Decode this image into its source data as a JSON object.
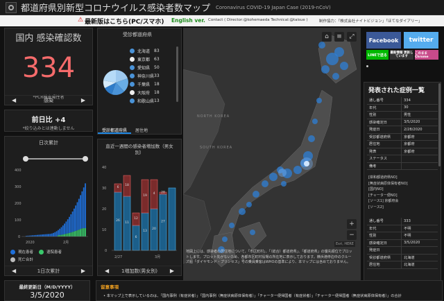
{
  "header": {
    "title": "都道府県別新型コロナウイルス感染者数マップ",
    "subtitle": "Coronavirus COVID-19 Japan Case (2019-nCoV)"
  },
  "banner": {
    "warn_icon": "⚠",
    "latest": "最新版はこちら(PC/スマホ)",
    "english": "English ver.",
    "contact": "Contact ( Director:@kohemaeda Technical:@taisue )",
    "producer": "制作協力：「株式会社ナイトビジョン」「ほてなダイアリー」"
  },
  "confirmed": {
    "title": "国内 感染確認数",
    "value": "334",
    "note": "*PCR検査陽性者",
    "nav_label": "感染"
  },
  "daily": {
    "title": "前日比 +4",
    "note": "*絞り込みとは連動しません"
  },
  "cumulative": {
    "title": "日次累計",
    "yticks": [
      "400",
      "300",
      "200",
      "100",
      "0"
    ],
    "xticks": [
      "2020",
      "2月"
    ],
    "legend": [
      "現在患者",
      "退院患者",
      "死亡合計"
    ],
    "nav_label": "1日次累計"
  },
  "prefectures": {
    "title": "受診都道府県",
    "items": [
      {
        "name": "北海道",
        "count": "83"
      },
      {
        "name": "東京都",
        "count": "63"
      },
      {
        "name": "愛知県",
        "count": "50"
      },
      {
        "name": "神奈川県",
        "count": "33"
      },
      {
        "name": "千葉県",
        "count": "18"
      },
      {
        "name": "大阪府",
        "count": "18"
      },
      {
        "name": "和歌山県",
        "count": "13"
      }
    ],
    "tab1": "受診都道府県",
    "tab2": "居住地"
  },
  "weekly": {
    "title": "直近一週間の感染者増加数（男女別）",
    "yticks": [
      "40",
      "30",
      "20",
      "10",
      "0"
    ],
    "xticks": [
      "2/27",
      "3月"
    ],
    "nav_label": "1増加数(男女別)",
    "bar_labels": [
      "26",
      "6",
      "11",
      "18",
      "6",
      "12",
      "13",
      "19",
      "20",
      "4",
      "27",
      "28"
    ]
  },
  "map": {
    "labels": [
      "NORTH KOREA",
      "SOUTH KOREA"
    ],
    "zoom_in": "+",
    "zoom_out": "−",
    "esri": "Esri, HERE",
    "caption": "地図上には、感染者の居住地について、「市区町村」、「（総合）都道府県」、「都道府県」の優先順位でプロットします。プロット先がないため、各都市区町村役場の所在地に表示しております。横浜港停泊中のクルーズ船「ダイヤモンド・プリンセス」号の乗員乗客はWHOの基準により、本マップには含めておりません。"
  },
  "social": {
    "facebook": "Facebook",
    "twitter": "twitter",
    "line": "LINEで送る",
    "latest": "最新情報 更新しています",
    "other": "このまま Chrome"
  },
  "case_panel": {
    "title": "発表された症例一覧",
    "case1": [
      {
        "k": "通し番号",
        "v": "334"
      },
      {
        "k": "年代",
        "v": "30"
      },
      {
        "k": "性別",
        "v": "男性"
      },
      {
        "k": "感染確定日",
        "v": "3/5/2020"
      },
      {
        "k": "発症日",
        "v": "2/28/2020"
      },
      {
        "k": "受診都道府県",
        "v": "京都府"
      },
      {
        "k": "居住地",
        "v": "京都府"
      },
      {
        "k": "発表",
        "v": "京都府"
      },
      {
        "k": "ステータス",
        "v": ""
      },
      {
        "k": "備考",
        "v": ""
      }
    ],
    "links": [
      "[岸和都道府県NO]",
      "[無症状病原体保有者NO]",
      "[国内NO]",
      "[チャーター便NO]",
      "[ソース1] 京都府会",
      "[ソース2]"
    ],
    "case2": [
      {
        "k": "通し番号",
        "v": "333"
      },
      {
        "k": "年代",
        "v": "不明"
      },
      {
        "k": "性別",
        "v": "不明"
      },
      {
        "k": "感染確定日",
        "v": "3/5/2020"
      },
      {
        "k": "発症日",
        "v": ""
      },
      {
        "k": "受診都道府県",
        "v": "北海道"
      },
      {
        "k": "居住地",
        "v": "北海道"
      }
    ]
  },
  "updated": {
    "label": "最終更新日（M/D/YYYY）",
    "date": "3/5/2020"
  },
  "notes": {
    "title": "留意事項",
    "text": "本マップ上で表示しているのは、「国内事例（有症状者）」「国内事例（無症状病原体保有者）」「チャーター便帰国者（有症状者）」「チャーター便帰国者（無症状病原体保有者）」の合計"
  }
}
